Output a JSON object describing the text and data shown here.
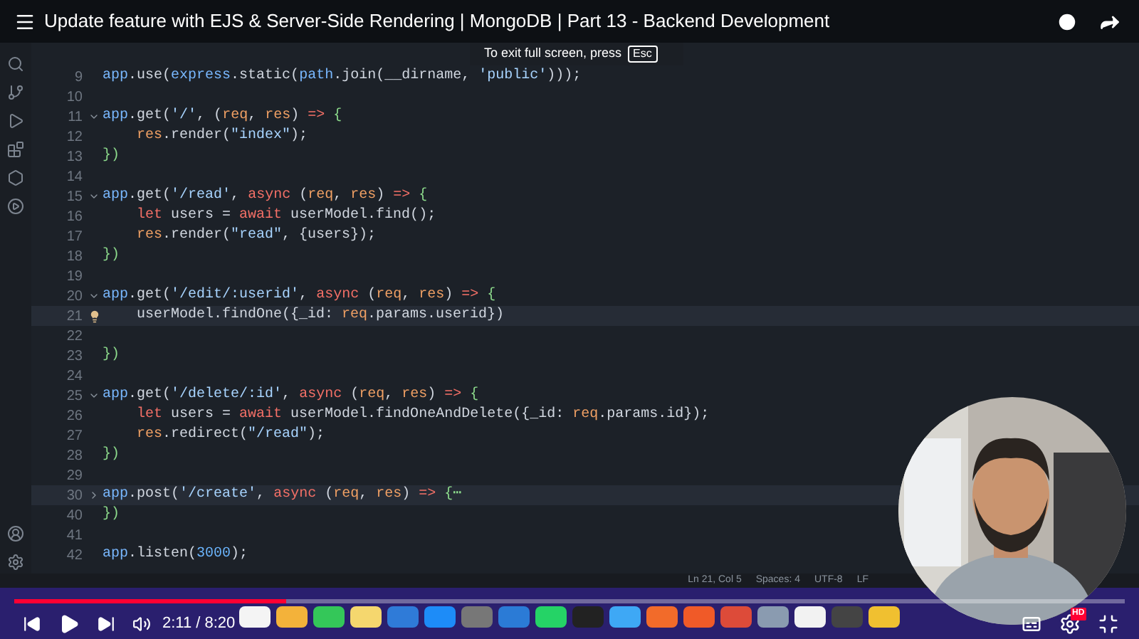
{
  "player": {
    "title": "Update feature with EJS & Server-Side Rendering | MongoDB | Part 13 - Backend Development",
    "fullscreen_hint": {
      "text": "To exit full screen, press",
      "key": "Esc"
    },
    "progress": {
      "level": 0.245
    },
    "time": "2:11 / 8:20",
    "quality_badge": "HD"
  },
  "editor": {
    "lines": [
      {
        "num": "9",
        "tokens": [
          {
            "text": "app",
            "kind": "obj"
          },
          {
            "text": ".use(",
            "kind": "p"
          },
          {
            "text": "express",
            "kind": "obj"
          },
          {
            "text": ".static(",
            "kind": "p"
          },
          {
            "text": "path",
            "kind": "obj"
          },
          {
            "text": ".join(",
            "kind": "p"
          },
          {
            "text": "__dirname, ",
            "kind": "p"
          },
          {
            "text": "'public'",
            "kind": "str"
          },
          {
            "text": ")));",
            "kind": "p"
          }
        ]
      },
      {
        "num": "10"
      },
      {
        "num": "11",
        "collapsed": false,
        "tokens": [
          {
            "text": "app",
            "kind": "obj"
          },
          {
            "text": ".get(",
            "kind": "p"
          },
          {
            "text": "'/'",
            "kind": "str"
          },
          {
            "text": ", (",
            "kind": "p"
          },
          {
            "text": "req",
            "kind": "param"
          },
          {
            "text": ", ",
            "kind": "p"
          },
          {
            "text": "res",
            "kind": "param"
          },
          {
            "text": ") ",
            "kind": "p"
          },
          {
            "text": "=>",
            "kind": "kw"
          },
          {
            "text": " {",
            "kind": "brace"
          }
        ]
      },
      {
        "num": "12",
        "tokens": [
          {
            "text": "    res",
            "kind": "param"
          },
          {
            "text": ".render(",
            "kind": "p"
          },
          {
            "text": "\"index\"",
            "kind": "str"
          },
          {
            "text": ");",
            "kind": "p"
          }
        ]
      },
      {
        "num": "13",
        "tokens": [
          {
            "text": "})",
            "kind": "brace"
          }
        ]
      },
      {
        "num": "14"
      },
      {
        "num": "15",
        "collapsed": false,
        "tokens": [
          {
            "text": "app",
            "kind": "obj"
          },
          {
            "text": ".get(",
            "kind": "p"
          },
          {
            "text": "'/read'",
            "kind": "str"
          },
          {
            "text": ", ",
            "kind": "p"
          },
          {
            "text": "async",
            "kind": "kw"
          },
          {
            "text": " (",
            "kind": "p"
          },
          {
            "text": "req",
            "kind": "param"
          },
          {
            "text": ", ",
            "kind": "p"
          },
          {
            "text": "res",
            "kind": "param"
          },
          {
            "text": ") ",
            "kind": "p"
          },
          {
            "text": "=>",
            "kind": "kw"
          },
          {
            "text": " {",
            "kind": "brace"
          }
        ]
      },
      {
        "num": "16",
        "tokens": [
          {
            "text": "    let",
            "kind": "kw"
          },
          {
            "text": " users = ",
            "kind": "p"
          },
          {
            "text": "await",
            "kind": "kw"
          },
          {
            "text": " userModel.find();",
            "kind": "p"
          }
        ]
      },
      {
        "num": "17",
        "tokens": [
          {
            "text": "    res",
            "kind": "param"
          },
          {
            "text": ".render(",
            "kind": "p"
          },
          {
            "text": "\"read\"",
            "kind": "str"
          },
          {
            "text": ", {users});",
            "kind": "p"
          }
        ]
      },
      {
        "num": "18",
        "tokens": [
          {
            "text": "})",
            "kind": "brace"
          }
        ]
      },
      {
        "num": "19"
      },
      {
        "num": "20",
        "collapsed": false,
        "tokens": [
          {
            "text": "app",
            "kind": "obj"
          },
          {
            "text": ".get(",
            "kind": "p"
          },
          {
            "text": "'/edit/:userid'",
            "kind": "str"
          },
          {
            "text": ", ",
            "kind": "p"
          },
          {
            "text": "async",
            "kind": "kw"
          },
          {
            "text": " (",
            "kind": "p"
          },
          {
            "text": "req",
            "kind": "param"
          },
          {
            "text": ", ",
            "kind": "p"
          },
          {
            "text": "res",
            "kind": "param"
          },
          {
            "text": ") ",
            "kind": "p"
          },
          {
            "text": "=>",
            "kind": "kw"
          },
          {
            "text": " {",
            "kind": "brace"
          }
        ]
      },
      {
        "num": "21",
        "highlighted": true,
        "bulb": true,
        "tokens": [
          {
            "text": "    userModel.findOne({_id: ",
            "kind": "p"
          },
          {
            "text": "req",
            "kind": "param"
          },
          {
            "text": ".params.userid})",
            "kind": "p"
          }
        ]
      },
      {
        "num": "22"
      },
      {
        "num": "23",
        "tokens": [
          {
            "text": "})",
            "kind": "brace"
          }
        ]
      },
      {
        "num": "24"
      },
      {
        "num": "25",
        "collapsed": false,
        "tokens": [
          {
            "text": "app",
            "kind": "obj"
          },
          {
            "text": ".get(",
            "kind": "p"
          },
          {
            "text": "'/delete/:id'",
            "kind": "str"
          },
          {
            "text": ", ",
            "kind": "p"
          },
          {
            "text": "async",
            "kind": "kw"
          },
          {
            "text": " (",
            "kind": "p"
          },
          {
            "text": "req",
            "kind": "param"
          },
          {
            "text": ", ",
            "kind": "p"
          },
          {
            "text": "res",
            "kind": "param"
          },
          {
            "text": ") ",
            "kind": "p"
          },
          {
            "text": "=>",
            "kind": "kw"
          },
          {
            "text": " {",
            "kind": "brace"
          }
        ]
      },
      {
        "num": "26",
        "tokens": [
          {
            "text": "    let",
            "kind": "kw"
          },
          {
            "text": " users = ",
            "kind": "p"
          },
          {
            "text": "await",
            "kind": "kw"
          },
          {
            "text": " userModel.findOneAndDelete({_id: ",
            "kind": "p"
          },
          {
            "text": "req",
            "kind": "param"
          },
          {
            "text": ".params.id});",
            "kind": "p"
          }
        ]
      },
      {
        "num": "27",
        "tokens": [
          {
            "text": "    res",
            "kind": "param"
          },
          {
            "text": ".redirect(",
            "kind": "p"
          },
          {
            "text": "\"/read\"",
            "kind": "str"
          },
          {
            "text": ");",
            "kind": "p"
          }
        ]
      },
      {
        "num": "28",
        "tokens": [
          {
            "text": "})",
            "kind": "brace"
          }
        ]
      },
      {
        "num": "29"
      },
      {
        "num": "30",
        "collapsed": true,
        "highlighted": true,
        "tokens": [
          {
            "text": "app",
            "kind": "obj"
          },
          {
            "text": ".post(",
            "kind": "p"
          },
          {
            "text": "'/create'",
            "kind": "str"
          },
          {
            "text": ", ",
            "kind": "p"
          },
          {
            "text": "async",
            "kind": "kw"
          },
          {
            "text": " (",
            "kind": "p"
          },
          {
            "text": "req",
            "kind": "param"
          },
          {
            "text": ", ",
            "kind": "p"
          },
          {
            "text": "res",
            "kind": "param"
          },
          {
            "text": ") ",
            "kind": "p"
          },
          {
            "text": "=>",
            "kind": "kw"
          },
          {
            "text": " {⋯",
            "kind": "brace"
          }
        ]
      },
      {
        "num": "40",
        "tokens": [
          {
            "text": "})",
            "kind": "brace"
          }
        ]
      },
      {
        "num": "41"
      },
      {
        "num": "42",
        "tokens": [
          {
            "text": "app",
            "kind": "obj"
          },
          {
            "text": ".listen(",
            "kind": "p"
          },
          {
            "text": "3000",
            "kind": "num"
          },
          {
            "text": ");",
            "kind": "p"
          }
        ]
      }
    ],
    "status_bar": [
      "Ln 21, Col 5",
      "Spaces: 4",
      "UTF-8",
      "LF"
    ]
  }
}
